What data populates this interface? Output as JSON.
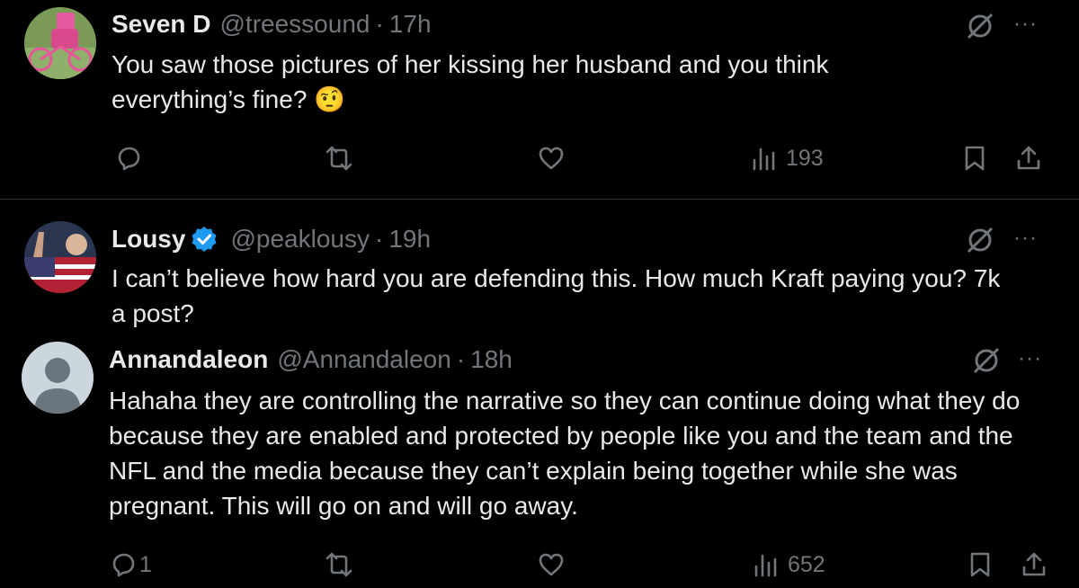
{
  "tweets": [
    {
      "name": "Seven D",
      "handle": "@treessound",
      "sep": "·",
      "time": "17h",
      "text": "You saw those pictures of her kissing her husband and you think everything’s fine? 🤨",
      "replies": "",
      "views": "193"
    },
    {
      "name": "Lousy",
      "handle": "@peaklousy",
      "sep": "·",
      "time": "19h",
      "text": "I can’t believe how hard you are defending this.  How much Kraft paying you? 7k a post?"
    },
    {
      "name": "Annandaleon",
      "handle": "@Annandaleon",
      "sep": "·",
      "time": "18h",
      "text": "Hahaha they are controlling the narrative so they can continue doing what they do because they are enabled and protected by people like you and the team and the NFL and the media because they can’t explain being together while she was pregnant. This will go on and will go away.",
      "replies": "1",
      "views": "652"
    }
  ],
  "icons": {
    "reply": "reply-icon",
    "retweet": "retweet-icon",
    "like": "like-icon",
    "views": "views-icon",
    "bookmark": "bookmark-icon",
    "share": "share-icon",
    "grok": "grok-icon",
    "more": "more-icon"
  },
  "colors": {
    "background": "#000000",
    "text": "#e7e9ea",
    "muted": "#71767b",
    "verified": "#1d9bf0",
    "divider": "#2f3336"
  },
  "more_label": "···"
}
